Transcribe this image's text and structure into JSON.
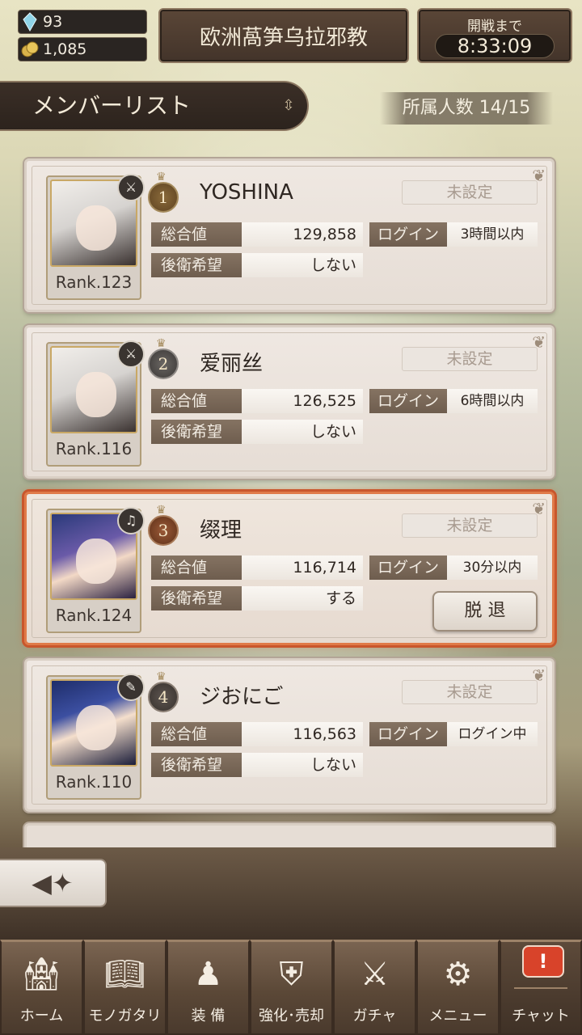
{
  "status": {
    "crystals": "93",
    "gold": "1,085"
  },
  "guild": {
    "name": "欧洲萵笋乌拉邪教"
  },
  "war": {
    "label": "開戦まで",
    "timer": "8:33:09"
  },
  "list": {
    "title": "メンバーリスト",
    "member_count": "所属人数 14/15"
  },
  "labels": {
    "total": "総合値",
    "login": "ログイン",
    "rear": "後衛希望"
  },
  "members": [
    {
      "rank": "1",
      "name": "YOSHINA",
      "role": "未設定",
      "total": "129,858",
      "login": "3時間以内",
      "rear": "しない",
      "rank_label": "Rank.123",
      "class_icon": "sword-icon"
    },
    {
      "rank": "2",
      "name": "爱丽丝",
      "role": "未設定",
      "total": "126,525",
      "login": "6時間以内",
      "rear": "しない",
      "rank_label": "Rank.116",
      "class_icon": "sword-icon"
    },
    {
      "rank": "3",
      "name": "缀理",
      "role": "未設定",
      "total": "116,714",
      "login": "30分以内",
      "rear": "する",
      "rank_label": "Rank.124",
      "class_icon": "harp-icon",
      "leave": "脱 退"
    },
    {
      "rank": "4",
      "name": "ジおにご",
      "role": "未設定",
      "total": "116,563",
      "login": "ログイン中",
      "rear": "しない",
      "rank_label": "Rank.110",
      "class_icon": "staff-icon"
    }
  ],
  "nav": {
    "home": "ホーム",
    "story": "モノガタリ",
    "equip": "装 備",
    "enhance": "強化･売却",
    "gacha": "ガチャ",
    "menu": "メニュー",
    "chat": "チャット",
    "chat_badge": "!"
  },
  "colors": {
    "highlight_border": "#e07a48",
    "panel_brown": "#43342a",
    "chat_badge": "#d8432a"
  }
}
